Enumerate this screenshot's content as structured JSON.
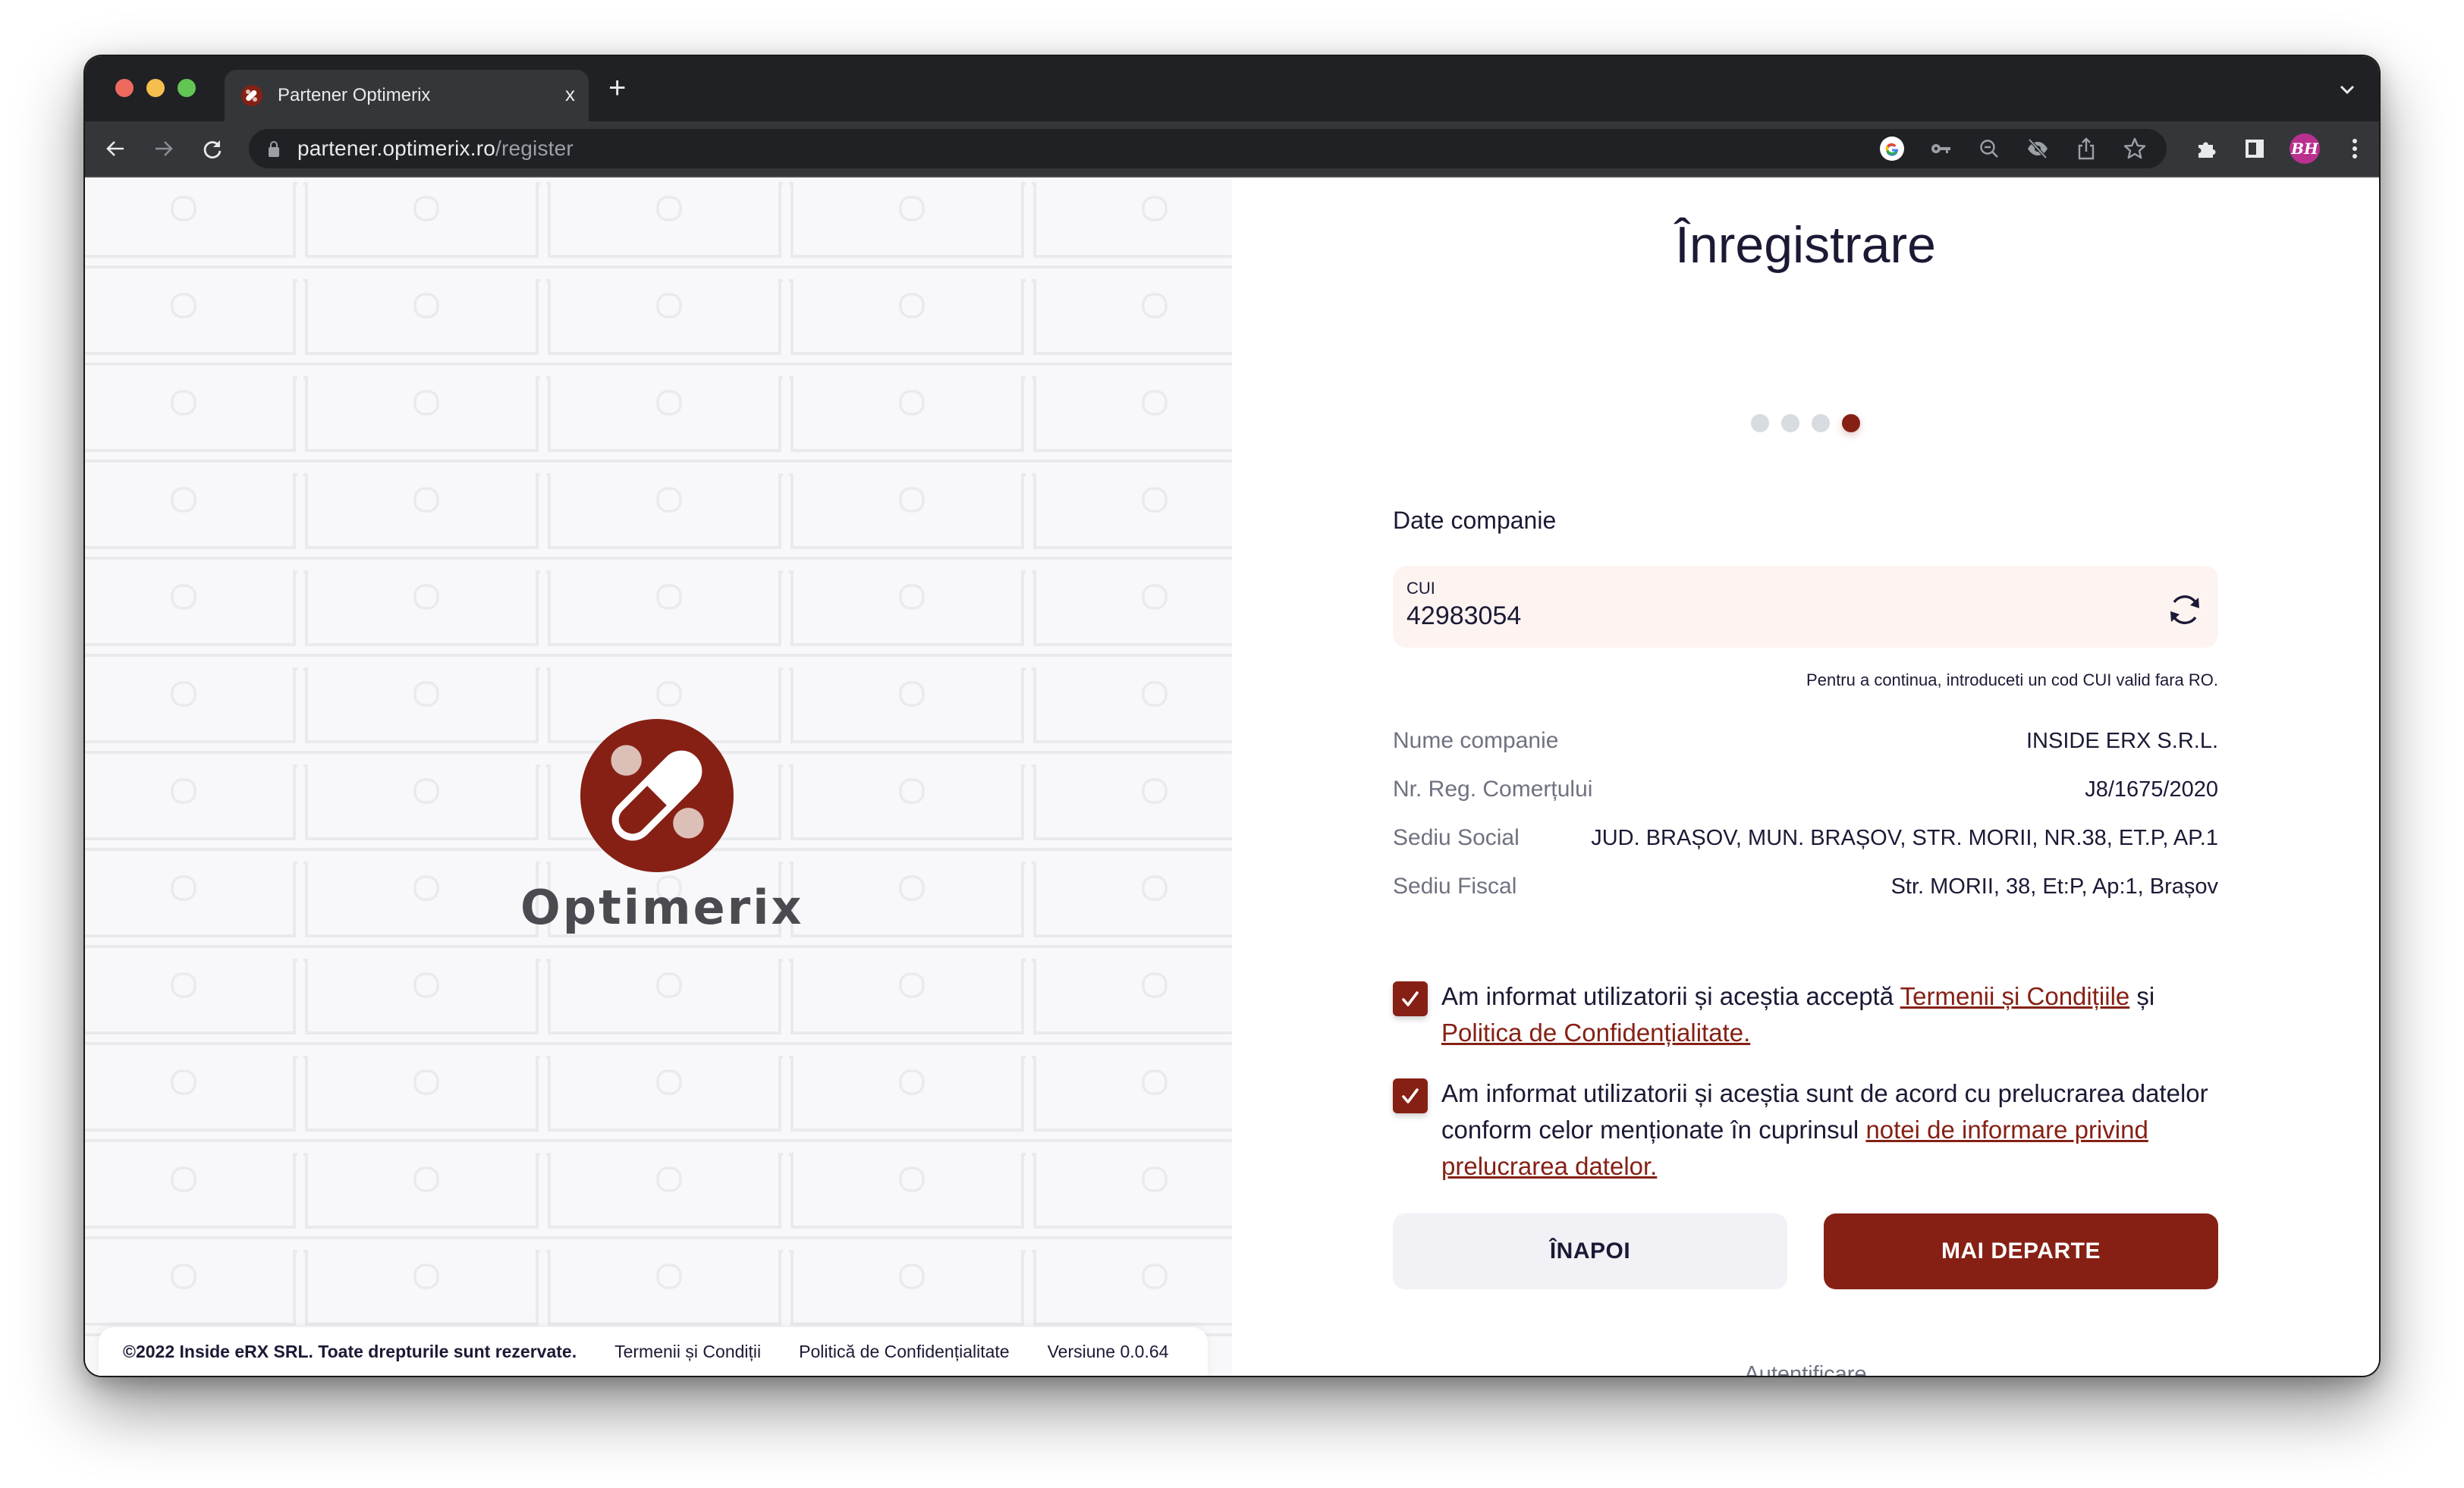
{
  "browser": {
    "tab": {
      "title": "Partener Optimerix",
      "favicon": "optimerix-pill-icon",
      "close_label": "x"
    },
    "new_tab_label": "+",
    "url": {
      "host": "partener.optimerix.ro",
      "path": "/register"
    },
    "omnibox_icons": [
      "google-icon",
      "key-icon",
      "zoom-out-icon",
      "eye-off-icon",
      "share-icon",
      "star-icon"
    ],
    "toolbar_icons": [
      "extensions-icon",
      "side-panel-icon",
      "profile-avatar",
      "kebab-menu-icon"
    ],
    "avatar_initials": "BH",
    "avatar_color": "#b9308f"
  },
  "brand": {
    "name": "Optimerix",
    "primary_color": "#862015",
    "accent_dot_color": "#dcbfb7"
  },
  "footer": {
    "copyright": "©2022 Inside eRX SRL. Toate drepturile sunt rezervate.",
    "terms": "Termenii și Condiții",
    "privacy": "Politică de Confidențialitate",
    "version": "Versiune 0.0.64"
  },
  "form": {
    "title": "Înregistrare",
    "stepper": {
      "total_steps": 4,
      "current_step": 4
    },
    "section_title": "Date companie",
    "cui": {
      "label": "CUI",
      "value": "42983054"
    },
    "helper_text": "Pentru a continua, introduceti un cod CUI valid fara RO.",
    "details": [
      {
        "label": "Nume companie",
        "value": "INSIDE ERX S.R.L."
      },
      {
        "label": "Nr. Reg. Comerțului",
        "value": "J8/1675/2020"
      },
      {
        "label": "Sediu Social",
        "value": "JUD. BRAȘOV, MUN. BRAȘOV, STR. MORII, NR.38, ET.P, AP.1"
      },
      {
        "label": "Sediu Fiscal",
        "value": "Str. MORII, 38, Et:P, Ap:1, Brașov"
      }
    ],
    "consents": [
      {
        "checked": true,
        "text_before": "Am informat utilizatorii și aceștia acceptă ",
        "link1": "Termenii și Condițiile",
        "text_middle": " și ",
        "link2": "Politica de Confidențialitate."
      },
      {
        "checked": true,
        "text_before": "Am informat utilizatorii și aceștia sunt de acord cu prelucrarea datelor conform celor menționate în cuprinsul ",
        "link1": "notei de informare privind prelucrarea datelor."
      }
    ],
    "back_button": "ÎNAPOI",
    "next_button": "MAI DEPARTE",
    "login_link": "Autentificare"
  }
}
